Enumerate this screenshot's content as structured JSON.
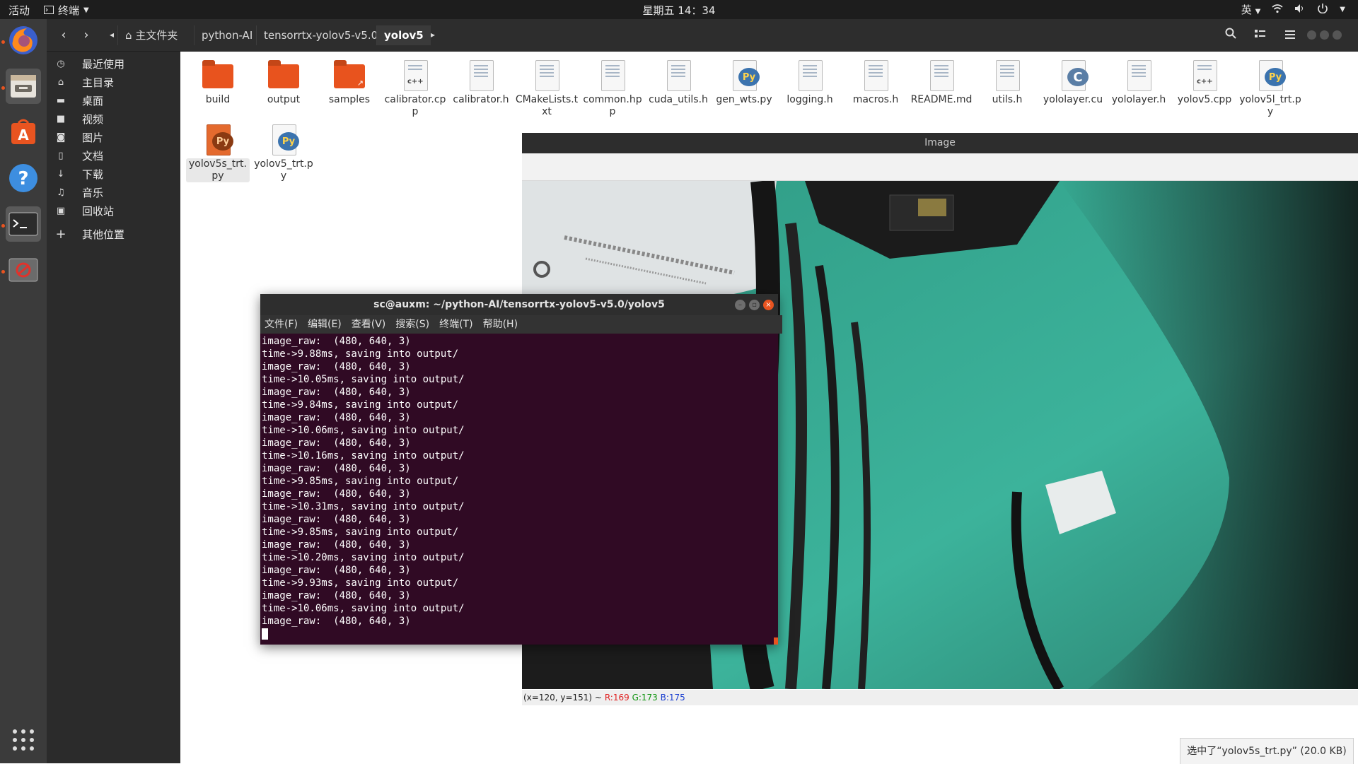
{
  "topbar": {
    "activities": "活动",
    "app_name": "终端",
    "clock": "星期五 14：34",
    "input_method": "英"
  },
  "dock": {
    "items": [
      "firefox",
      "files",
      "software-center",
      "help",
      "terminal",
      "disabled-app"
    ]
  },
  "files": {
    "breadcrumbs": [
      "主文件夹",
      "python-AI",
      "tensorrtx-yolov5-v5.0",
      "yolov5"
    ],
    "sidebar": [
      "最近使用",
      "主目录",
      "桌面",
      "视频",
      "图片",
      "文档",
      "下载",
      "音乐",
      "回收站",
      "其他位置"
    ],
    "items": [
      {
        "name": "build",
        "type": "folder"
      },
      {
        "name": "output",
        "type": "folder"
      },
      {
        "name": "samples",
        "type": "folder-link"
      },
      {
        "name": "calibrator.cpp",
        "type": "cpp"
      },
      {
        "name": "calibrator.h",
        "type": "text"
      },
      {
        "name": "CMakeLists.txt",
        "type": "text"
      },
      {
        "name": "common.hpp",
        "type": "text"
      },
      {
        "name": "cuda_utils.h",
        "type": "text"
      },
      {
        "name": "gen_wts.py",
        "type": "python"
      },
      {
        "name": "logging.h",
        "type": "text"
      },
      {
        "name": "macros.h",
        "type": "text"
      },
      {
        "name": "README.md",
        "type": "text"
      },
      {
        "name": "utils.h",
        "type": "text"
      },
      {
        "name": "yololayer.cu",
        "type": "c"
      },
      {
        "name": "yololayer.h",
        "type": "text"
      },
      {
        "name": "yolov5.cpp",
        "type": "cpp"
      },
      {
        "name": "yolov5l_trt.py",
        "type": "python"
      },
      {
        "name": "yolov5s_trt.py",
        "type": "python-selected"
      },
      {
        "name": "yolov5_trt.py",
        "type": "python"
      }
    ],
    "selection_status": "选中了“yolov5s_trt.py” (20.0 KB)"
  },
  "image_window": {
    "title": "Image",
    "status_coords": "(x=120, y=151) ~",
    "status_r": "R:169",
    "status_g": "G:173",
    "status_b": "B:175",
    "colors": {
      "r": "#e02020",
      "g": "#129512",
      "b": "#1b3fd0"
    }
  },
  "terminal": {
    "title": "sc@auxm: ~/python-AI/tensorrtx-yolov5-v5.0/yolov5",
    "menu": [
      "文件(F)",
      "编辑(E)",
      "查看(V)",
      "搜索(S)",
      "终端(T)",
      "帮助(H)"
    ],
    "lines": [
      "image_raw:  (480, 640, 3)",
      "time->9.88ms, saving into output/",
      "image_raw:  (480, 640, 3)",
      "time->10.05ms, saving into output/",
      "image_raw:  (480, 640, 3)",
      "time->9.84ms, saving into output/",
      "image_raw:  (480, 640, 3)",
      "time->10.06ms, saving into output/",
      "image_raw:  (480, 640, 3)",
      "time->10.16ms, saving into output/",
      "image_raw:  (480, 640, 3)",
      "time->9.85ms, saving into output/",
      "image_raw:  (480, 640, 3)",
      "time->10.31ms, saving into output/",
      "image_raw:  (480, 640, 3)",
      "time->9.85ms, saving into output/",
      "image_raw:  (480, 640, 3)",
      "time->10.20ms, saving into output/",
      "image_raw:  (480, 640, 3)",
      "time->9.93ms, saving into output/",
      "image_raw:  (480, 640, 3)",
      "time->10.06ms, saving into output/",
      "image_raw:  (480, 640, 3)"
    ]
  }
}
